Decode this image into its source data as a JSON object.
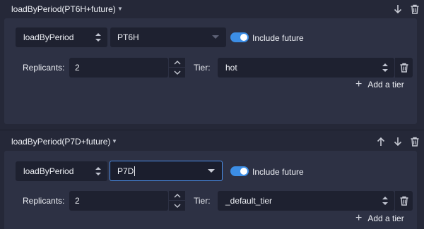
{
  "rules": [
    {
      "title": "loadByPeriod(PT6H+future)",
      "rule_type": "loadByPeriod",
      "period": "PT6H",
      "include_future_label": "Include future",
      "include_future": true,
      "replicants_label": "Replicants:",
      "replicants": "2",
      "tier_label": "Tier:",
      "tier": "hot",
      "add_tier_label": "Add a tier",
      "header_icons": [
        "arrow-down-icon",
        "trash-icon"
      ]
    },
    {
      "title": "loadByPeriod(P7D+future)",
      "rule_type": "loadByPeriod",
      "period": "P7D",
      "include_future_label": "Include future",
      "include_future": true,
      "replicants_label": "Replicants:",
      "replicants": "2",
      "tier_label": "Tier:",
      "tier": "_default_tier",
      "add_tier_label": "Add a tier",
      "header_icons": [
        "arrow-up-icon",
        "arrow-down-icon",
        "trash-icon"
      ]
    }
  ],
  "colors": {
    "background": "#252838",
    "card": "#2d3144",
    "input": "#1e2130",
    "accent": "#3c8ee6",
    "focus_border": "#4b8ee8"
  }
}
